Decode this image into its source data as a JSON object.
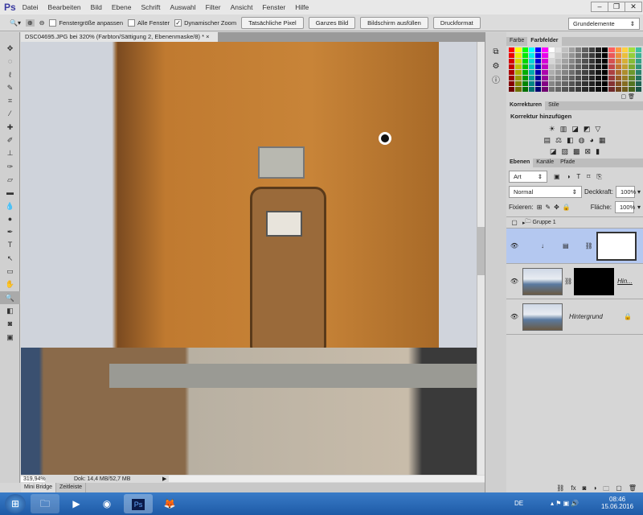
{
  "app": {
    "logo": "Ps",
    "menu": [
      "Datei",
      "Bearbeiten",
      "Bild",
      "Ebene",
      "Schrift",
      "Auswahl",
      "Filter",
      "Ansicht",
      "Fenster",
      "Hilfe"
    ]
  },
  "options": {
    "fit_window": "Fenstergröße anpassen",
    "all_windows": "Alle Fenster",
    "dynamic_zoom": "Dynamischer Zoom",
    "dynamic_zoom_checked": "✓",
    "buttons": [
      "Tatsächliche Pixel",
      "Ganzes Bild",
      "Bildschirm ausfüllen",
      "Druckformat"
    ],
    "workspace": "Grundelemente"
  },
  "document": {
    "tab_title": "DSC04695.JPG bei 320% (Farbton/Sättigung 2, Ebenenmaske/8) *",
    "close": "×"
  },
  "status": {
    "zoom": "319,94%",
    "doc": "Dok: 14,4 MB/52,7 MB"
  },
  "bottom_tabs": [
    "Mini Bridge",
    "Zeitleiste"
  ],
  "panels": {
    "color_tabs": [
      "Farbe",
      "Farbfelder"
    ],
    "swatch_colors": [
      "#ff0000",
      "#ffff00",
      "#00ff00",
      "#00ffff",
      "#0000ff",
      "#ff00ff",
      "#ffffff",
      "#e0e0e0",
      "#c0c0c0",
      "#a0a0a0",
      "#808080",
      "#606060",
      "#404040",
      "#202020",
      "#000000",
      "#ff6060",
      "#ff9a40",
      "#ffd040",
      "#a0e040",
      "#40c0a0"
    ],
    "adjust_tabs": [
      "Korrekturen",
      "Stile"
    ],
    "adjust_title": "Korrektur hinzufügen",
    "layers_tabs": [
      "Ebenen",
      "Kanäle",
      "Pfade"
    ],
    "filter_kind": "Art",
    "blend_mode": "Normal",
    "opacity_label": "Deckkraft:",
    "opacity": "100%",
    "lock_label": "Fixieren:",
    "fill_label": "Fläche:",
    "fill": "100%",
    "layers": [
      {
        "name": "Gruppe 1"
      },
      {
        "name": ""
      },
      {
        "name": "Hin..."
      },
      {
        "name": "Hintergrund"
      }
    ]
  },
  "taskbar": {
    "lang": "DE",
    "time": "08:46",
    "date": "15.06.2016"
  }
}
